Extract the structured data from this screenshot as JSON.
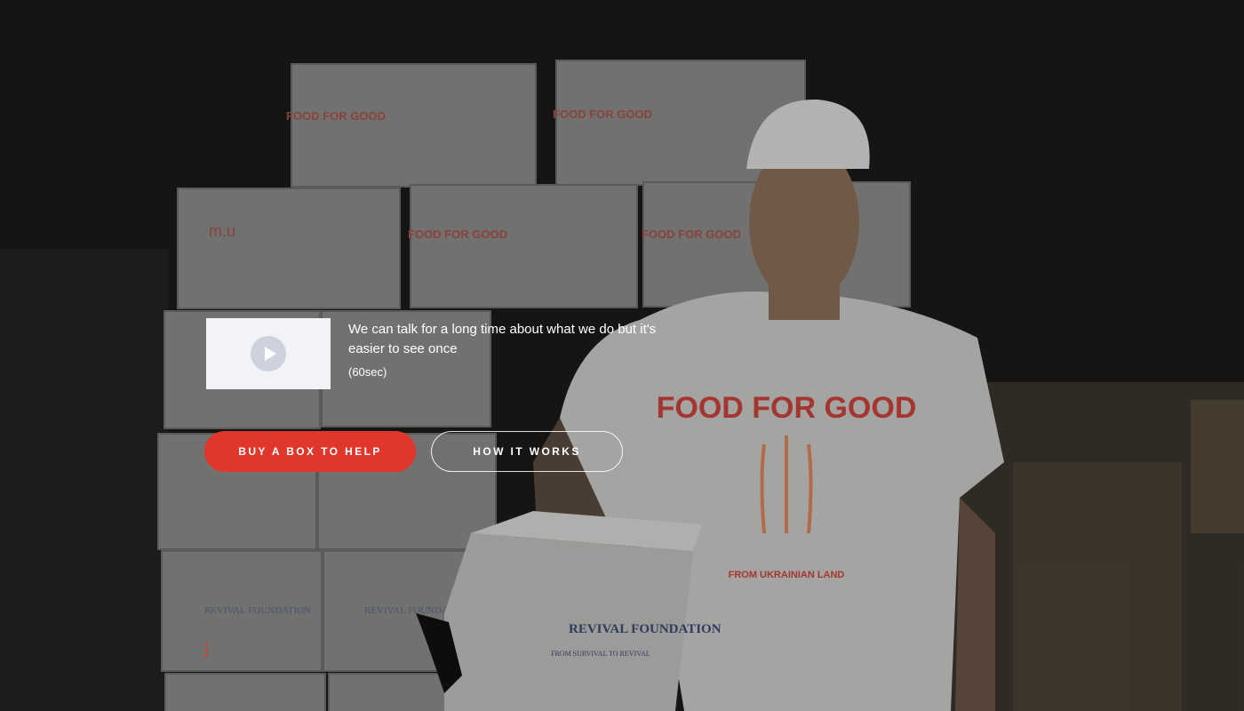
{
  "video": {
    "caption": "We can talk for a long time about what we do but it's easier to see once",
    "duration": "(60sec)",
    "play_icon": "play-icon"
  },
  "buttons": {
    "primary_label": "BUY A BOX TO HELP",
    "secondary_label": "HOW IT WORKS"
  },
  "background": {
    "box_brand_1": "FOOD FOR GOOD",
    "box_brand_2": "REVIVAL FOUNDATION",
    "box_tagline": "FROM SURVIVAL TO REVIVAL",
    "shirt_arc": "FROM UKRAINIAN LAND",
    "box_brand_3": "m.u"
  },
  "colors": {
    "accent": "#e1362b",
    "overlay": "#171615",
    "card": "#f1f3f6"
  }
}
